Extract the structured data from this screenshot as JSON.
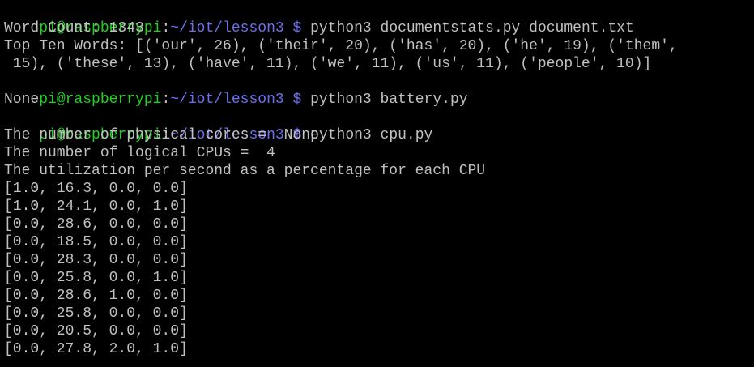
{
  "prompt": {
    "user_host": "pi@raspberrypi",
    "colon": ":",
    "path": "~/iot/lesson3",
    "dollar": " $ "
  },
  "colors": {
    "background": "#000000",
    "user_host": "#1fd21f",
    "path": "#6e6ef0",
    "text": "#c0c0c0"
  },
  "session": [
    {
      "type": "prompt",
      "command": "python3 documentstats.py document.txt"
    },
    {
      "type": "output",
      "text": "Word Count: 1343"
    },
    {
      "type": "output",
      "text": "Top Ten Words: [('our', 26), ('their', 20), ('has', 20), ('he', 19), ('them',"
    },
    {
      "type": "output",
      "text": " 15), ('these', 13), ('have', 11), ('we', 11), ('us', 11), ('people', 10)]"
    },
    {
      "type": "prompt",
      "command": "python3 battery.py"
    },
    {
      "type": "output",
      "text": "None"
    },
    {
      "type": "prompt",
      "command": "python3 cpu.py"
    },
    {
      "type": "output",
      "text": "The number of physical cores =  None"
    },
    {
      "type": "output",
      "text": "The number of logical CPUs =  4"
    },
    {
      "type": "output",
      "text": "The utilization per second as a percentage for each CPU"
    },
    {
      "type": "output",
      "text": "[1.0, 16.3, 0.0, 0.0]"
    },
    {
      "type": "output",
      "text": "[1.0, 24.1, 0.0, 1.0]"
    },
    {
      "type": "output",
      "text": "[0.0, 28.6, 0.0, 0.0]"
    },
    {
      "type": "output",
      "text": "[0.0, 18.5, 0.0, 0.0]"
    },
    {
      "type": "output",
      "text": "[0.0, 28.3, 0.0, 0.0]"
    },
    {
      "type": "output",
      "text": "[0.0, 25.8, 0.0, 1.0]"
    },
    {
      "type": "output",
      "text": "[0.0, 28.6, 1.0, 0.0]"
    },
    {
      "type": "output",
      "text": "[0.0, 25.8, 0.0, 0.0]"
    },
    {
      "type": "output",
      "text": "[0.0, 20.5, 0.0, 0.0]"
    },
    {
      "type": "output",
      "text": "[0.0, 27.8, 2.0, 1.0]"
    }
  ]
}
